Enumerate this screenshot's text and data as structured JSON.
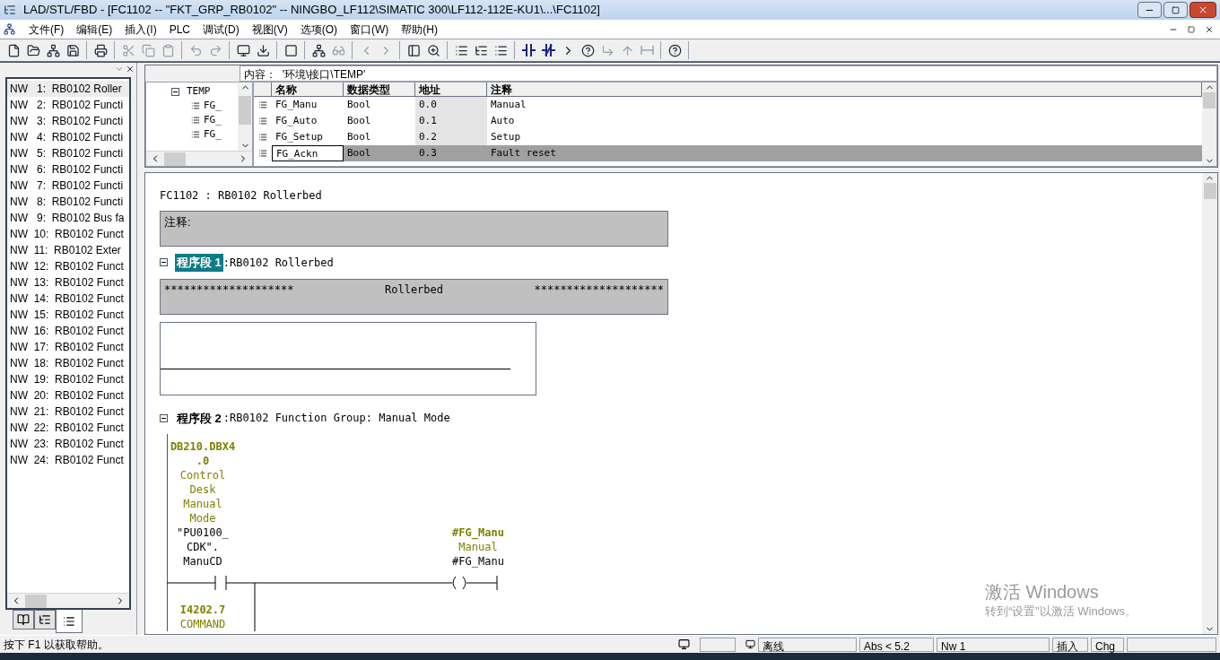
{
  "window": {
    "title": "LAD/STL/FBD  - [FC1102 -- \"FKT_GRP_RB0102\" -- NINGBO_LF112\\SIMATIC 300\\LF112-112E-KU1\\...\\FC1102]"
  },
  "menu": [
    "文件(F)",
    "编辑(E)",
    "插入(I)",
    "PLC",
    "调试(D)",
    "视图(V)",
    "选项(O)",
    "窗口(W)",
    "帮助(H)"
  ],
  "networks_list": {
    "items": [
      {
        "label": "NW   1:  RB0102 Roller",
        "selected": true
      },
      {
        "label": "NW   2:  RB0102 Functi",
        "selected": false
      },
      {
        "label": "NW   3:  RB0102 Functi",
        "selected": false
      },
      {
        "label": "NW   4:  RB0102 Functi",
        "selected": false
      },
      {
        "label": "NW   5:  RB0102 Functi",
        "selected": false
      },
      {
        "label": "NW   6:  RB0102 Functi",
        "selected": false
      },
      {
        "label": "NW   7:  RB0102 Functi",
        "selected": false
      },
      {
        "label": "NW   8:  RB0102 Functi",
        "selected": false
      },
      {
        "label": "NW   9:  RB0102 Bus fa",
        "selected": false
      },
      {
        "label": "NW  10:  RB0102 Funct",
        "selected": false
      },
      {
        "label": "NW  11:  RB0102 Exter",
        "selected": false
      },
      {
        "label": "NW  12:  RB0102 Funct",
        "selected": false
      },
      {
        "label": "NW  13:  RB0102 Funct",
        "selected": false
      },
      {
        "label": "NW  14:  RB0102 Funct",
        "selected": false
      },
      {
        "label": "NW  15:  RB0102 Funct",
        "selected": false
      },
      {
        "label": "NW  16:  RB0102 Funct",
        "selected": false
      },
      {
        "label": "NW  17:  RB0102 Funct",
        "selected": false
      },
      {
        "label": "NW  18:  RB0102 Funct",
        "selected": false
      },
      {
        "label": "NW  19:  RB0102 Funct",
        "selected": false
      },
      {
        "label": "NW  20:  RB0102 Funct",
        "selected": false
      },
      {
        "label": "NW  21:  RB0102 Funct",
        "selected": false
      },
      {
        "label": "NW  22:  RB0102 Funct",
        "selected": false
      },
      {
        "label": "NW  23:  RB0102 Funct",
        "selected": false
      },
      {
        "label": "NW  24:  RB0102 Funct",
        "selected": false
      }
    ],
    "tabs": [
      {
        "selected": false
      },
      {
        "selected": false
      },
      {
        "selected": true
      }
    ]
  },
  "interface": {
    "content_label": "内容：  '环境\\接口\\TEMP'",
    "tree": {
      "label": "TEMP",
      "expanded": true,
      "children": [
        {
          "label": "FG_"
        },
        {
          "label": "FG_"
        },
        {
          "label": "FG_"
        }
      ]
    },
    "columns": [
      "名称",
      "数据类型",
      "地址",
      "注释"
    ],
    "rows": [
      {
        "name": "FG_Manu",
        "type": "Bool",
        "address": "0.0",
        "comment": "Manual",
        "selected": false
      },
      {
        "name": "FG_Auto",
        "type": "Bool",
        "address": "0.1",
        "comment": "Auto",
        "selected": false
      },
      {
        "name": "FG_Setup",
        "type": "Bool",
        "address": "0.2",
        "comment": "Setup",
        "selected": false
      },
      {
        "name": "FG_Ackn",
        "type": "Bool",
        "address": "0.3",
        "comment": "Fault reset",
        "selected": true
      }
    ]
  },
  "editor": {
    "block_title": "FC1102 : RB0102 Rollerbed",
    "block_comment": "注释:",
    "networks": [
      {
        "label": "程序段 1",
        "title": ":RB0102 Rollerbed",
        "expanded": true,
        "selected": true,
        "kind": "empty",
        "comment": [
          "********************",
          "Rollerbed",
          "********************"
        ]
      },
      {
        "label": "程序段 2",
        "title": ":RB0102 Function Group: Manual Mode",
        "expanded": true,
        "selected": false,
        "kind": "ladder",
        "contact": {
          "address": [
            "DB210.DBX4",
            ".0"
          ],
          "comment": [
            "Control",
            "Desk",
            "Manual",
            "Mode"
          ],
          "symbol": [
            "\"PU0100_",
            "CDK\".",
            "ManuCD"
          ]
        },
        "coil": {
          "address": "#FG_Manu",
          "comment": "Manual",
          "symbol": "#FG_Manu"
        },
        "contact2": {
          "address": "I4202.7",
          "comment": "COMMAND"
        }
      }
    ]
  },
  "status_bar": {
    "help": "按下 F1 以获取帮助。",
    "mode": "离线",
    "abs": "Abs < 5.2",
    "network": "Nw 1",
    "insert": "插入",
    "chg": "Chg"
  },
  "activation": {
    "title": "激活 Windows",
    "subtitle": "转到“设置”以激活 Windows。"
  }
}
